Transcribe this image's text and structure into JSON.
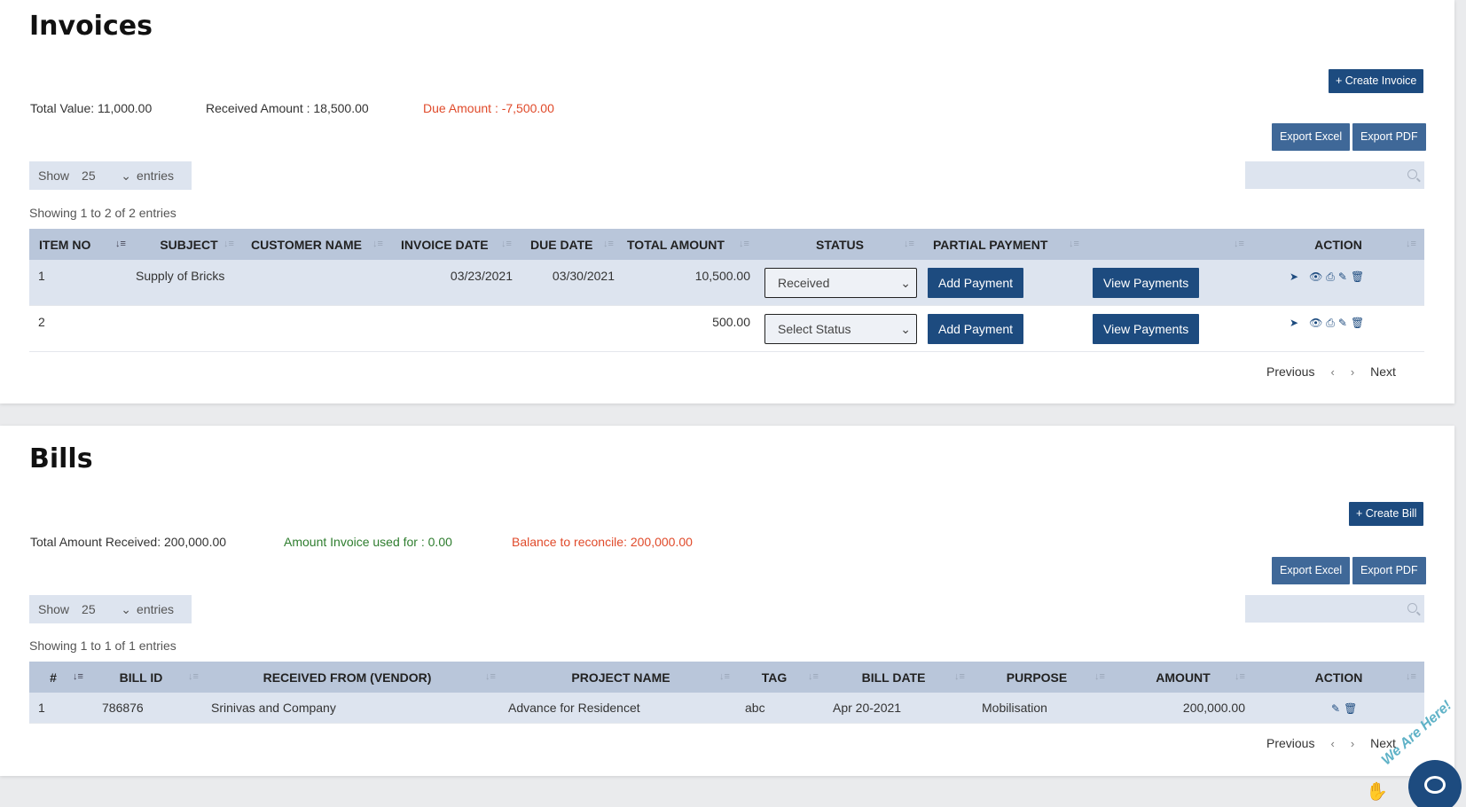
{
  "invoices": {
    "title": "Invoices",
    "create_label": "+ Create Invoice",
    "total_value": "Total Value: 11,000.00",
    "received_amount": "Received Amount : 18,500.00",
    "due_amount": "Due Amount : -7,500.00",
    "export_excel": "Export Excel",
    "export_pdf": "Export PDF",
    "show_label": "Show",
    "entries_value": "25",
    "entries_label": "entries",
    "showing_text": "Showing 1 to 2 of 2 entries",
    "columns": [
      "ITEM NO",
      "SUBJECT",
      "CUSTOMER NAME",
      "INVOICE DATE",
      "DUE DATE",
      "TOTAL AMOUNT",
      "STATUS",
      "PARTIAL PAYMENT",
      "",
      "ACTION"
    ],
    "rows": [
      {
        "item_no": "1",
        "subject": "Supply of Bricks",
        "customer": "",
        "invoice_date": "03/23/2021",
        "due_date": "03/30/2021",
        "total": "10,500.00",
        "status": "Received",
        "add_payment": "Add Payment",
        "view_payments": "View Payments"
      },
      {
        "item_no": "2",
        "subject": "",
        "customer": "",
        "invoice_date": "",
        "due_date": "",
        "total": "500.00",
        "status": "Select Status",
        "add_payment": "Add Payment",
        "view_payments": "View Payments"
      }
    ],
    "pager": {
      "previous": "Previous",
      "next": "Next"
    }
  },
  "bills": {
    "title": "Bills",
    "create_label": "+ Create Bill",
    "total_received": "Total Amount Received: 200,000.00",
    "invoice_used": "Amount Invoice used for : 0.00",
    "balance": "Balance to reconcile: 200,000.00",
    "export_excel": "Export Excel",
    "export_pdf": "Export PDF",
    "show_label": "Show",
    "entries_value": "25",
    "entries_label": "entries",
    "showing_text": "Showing 1 to 1 of 1 entries",
    "columns": [
      "#",
      "BILL ID",
      "RECEIVED FROM (VENDOR)",
      "PROJECT NAME",
      "TAG",
      "BILL DATE",
      "PURPOSE",
      "AMOUNT",
      "ACTION"
    ],
    "rows": [
      {
        "num": "1",
        "bill_id": "786876",
        "vendor": "Srinivas and Company",
        "project": "Advance for Residencet",
        "tag": "abc",
        "bill_date": "Apr 20-2021",
        "purpose": "Mobilisation",
        "amount": "200,000.00"
      }
    ],
    "pager": {
      "previous": "Previous",
      "next": "Next"
    }
  },
  "chat_widget": {
    "label": "We Are Here!"
  },
  "colors": {
    "primary": "#1d4b7f",
    "header_bg": "#b9c6da",
    "row_alt": "#dde4ef",
    "due_red": "#e04a2a",
    "green": "#2e7d2e"
  }
}
